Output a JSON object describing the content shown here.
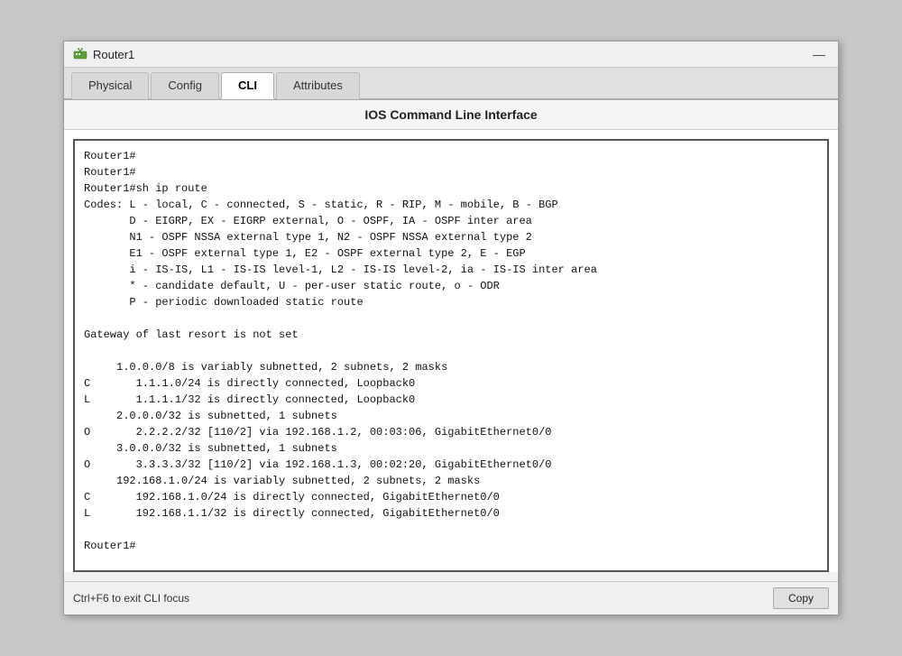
{
  "window": {
    "title": "Router1",
    "minimize_label": "—"
  },
  "tabs": [
    {
      "id": "physical",
      "label": "Physical",
      "active": false
    },
    {
      "id": "config",
      "label": "Config",
      "active": false
    },
    {
      "id": "cli",
      "label": "CLI",
      "active": true
    },
    {
      "id": "attributes",
      "label": "Attributes",
      "active": false
    }
  ],
  "cli": {
    "header": "IOS Command Line Interface",
    "terminal_content": "Router1#\nRouter1#\nRouter1#sh ip route\nCodes: L - local, C - connected, S - static, R - RIP, M - mobile, B - BGP\n       D - EIGRP, EX - EIGRP external, O - OSPF, IA - OSPF inter area\n       N1 - OSPF NSSA external type 1, N2 - OSPF NSSA external type 2\n       E1 - OSPF external type 1, E2 - OSPF external type 2, E - EGP\n       i - IS-IS, L1 - IS-IS level-1, L2 - IS-IS level-2, ia - IS-IS inter area\n       * - candidate default, U - per-user static route, o - ODR\n       P - periodic downloaded static route\n\nGateway of last resort is not set\n\n     1.0.0.0/8 is variably subnetted, 2 subnets, 2 masks\nC       1.1.1.0/24 is directly connected, Loopback0\nL       1.1.1.1/32 is directly connected, Loopback0\n     2.0.0.0/32 is subnetted, 1 subnets\nO       2.2.2.2/32 [110/2] via 192.168.1.2, 00:03:06, GigabitEthernet0/0\n     3.0.0.0/32 is subnetted, 1 subnets\nO       3.3.3.3/32 [110/2] via 192.168.1.3, 00:02:20, GigabitEthernet0/0\n     192.168.1.0/24 is variably subnetted, 2 subnets, 2 masks\nC       192.168.1.0/24 is directly connected, GigabitEthernet0/0\nL       192.168.1.1/32 is directly connected, GigabitEthernet0/0\n\nRouter1#"
  },
  "status_bar": {
    "hint_text": "Ctrl+F6 to exit CLI focus",
    "copy_button_label": "Copy"
  }
}
